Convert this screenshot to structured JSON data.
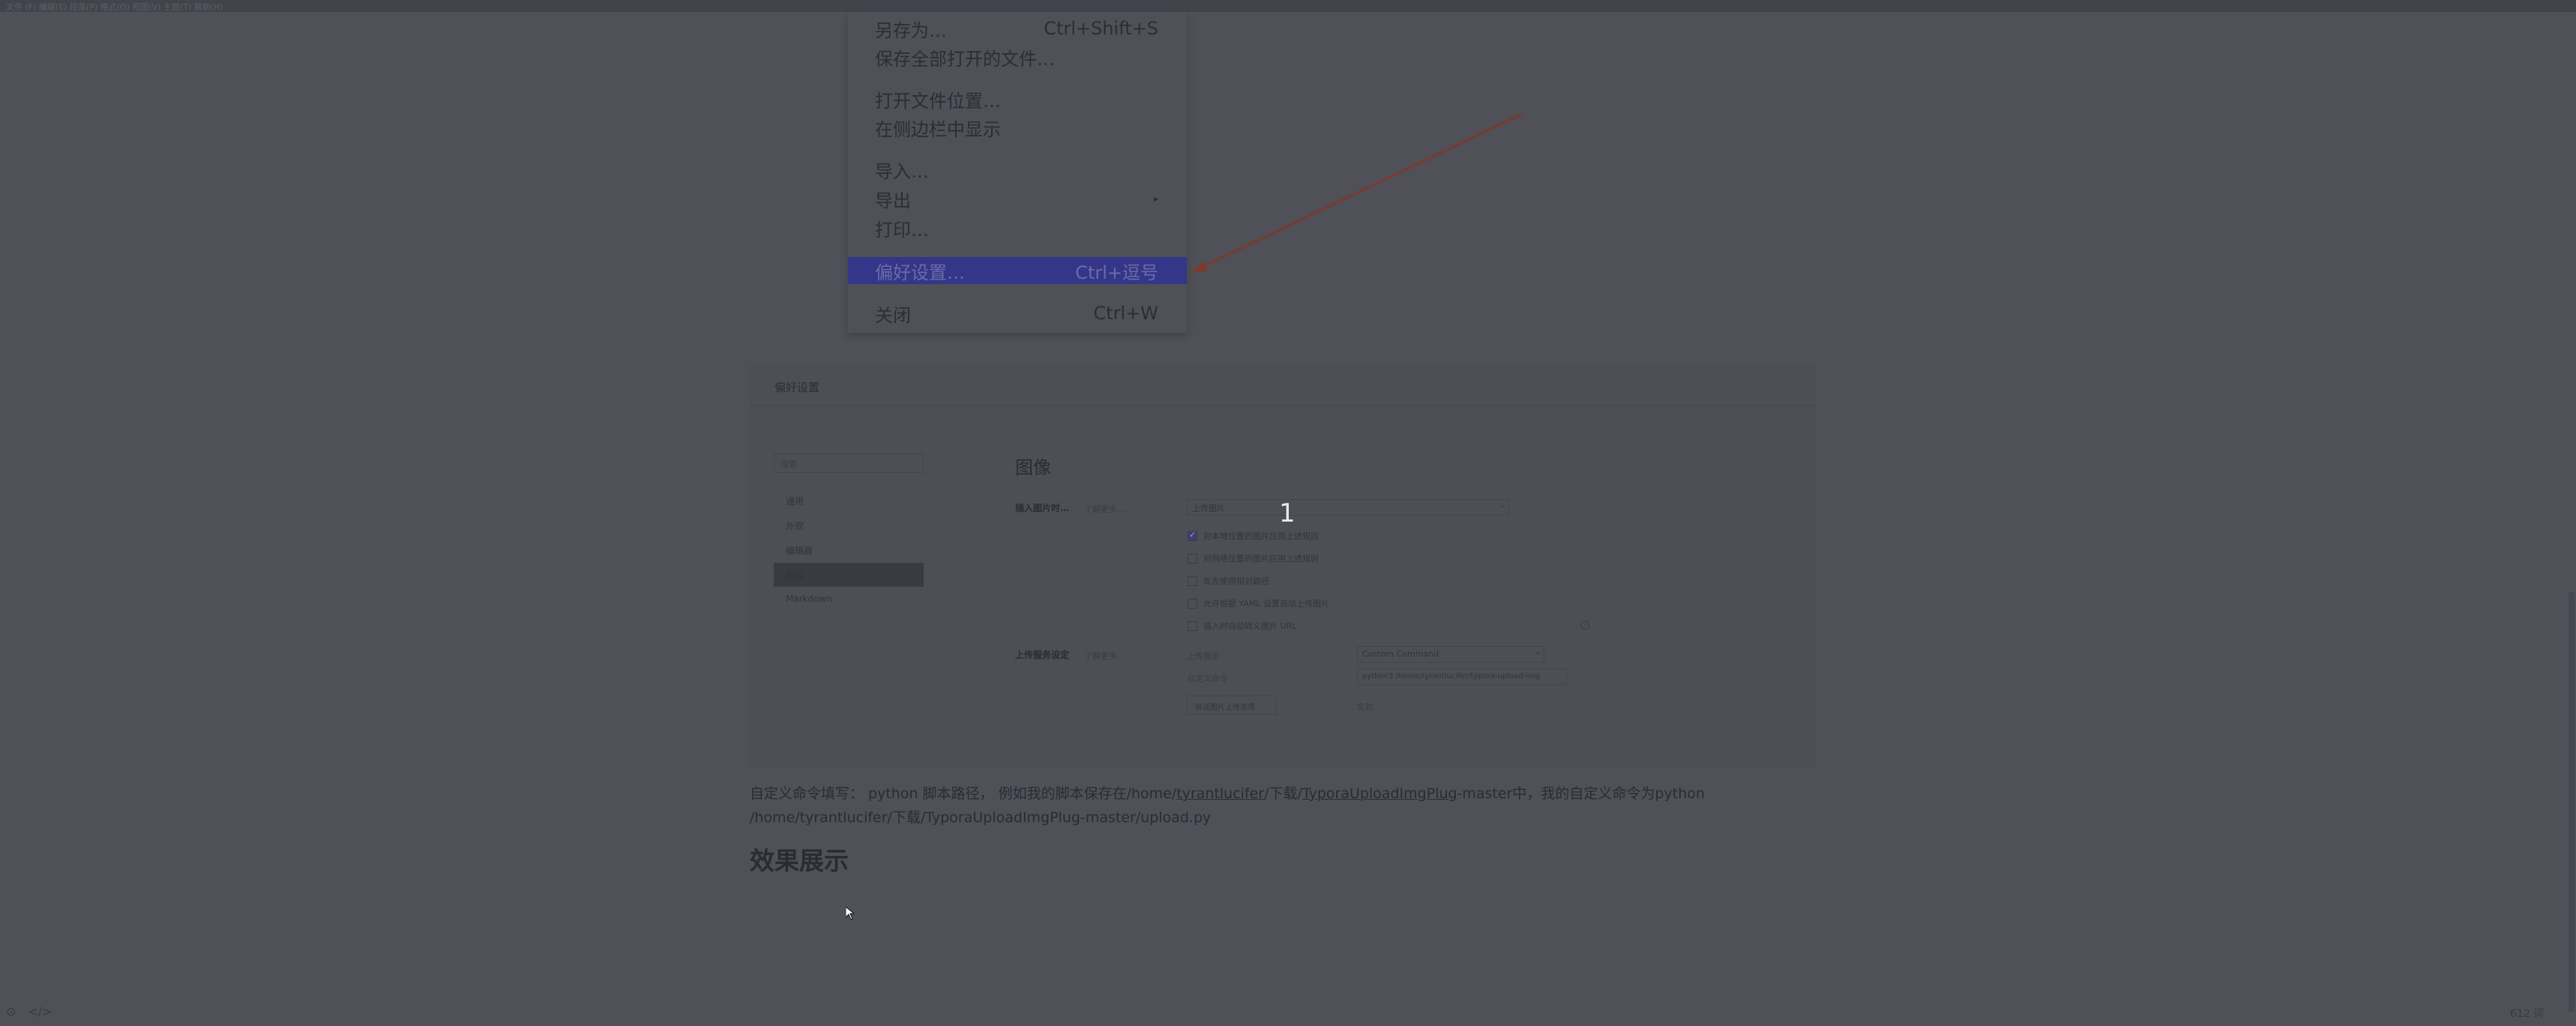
{
  "topbar": {
    "text": "文件 (F)  编辑(E)  段落(P)  格式(O)  视图(V)  主题(T)  帮助(H)"
  },
  "menu": {
    "items": [
      {
        "label": "另存为…",
        "shortcut": "Ctrl+Shift+S"
      },
      {
        "label": "保存全部打开的文件…",
        "shortcut": ""
      },
      {
        "label": "打开文件位置…",
        "shortcut": ""
      },
      {
        "label": "在侧边栏中显示",
        "shortcut": ""
      },
      {
        "label": "导入…",
        "shortcut": ""
      },
      {
        "label": "导出",
        "shortcut": ""
      },
      {
        "label": "打印…",
        "shortcut": ""
      },
      {
        "label": "偏好设置…",
        "shortcut": "Ctrl+逗号"
      },
      {
        "label": "关闭",
        "shortcut": "Ctrl+W"
      }
    ],
    "active_index": 7,
    "submenu_glyph": "▸"
  },
  "annotation": {
    "arrow_color": "#7a3a2e",
    "number": "1"
  },
  "prefs": {
    "title": "偏好设置",
    "search_placeholder": "搜索",
    "nav": [
      "通用",
      "外观",
      "编辑器",
      "图像",
      "Markdown"
    ],
    "selected_nav": 3,
    "heading": "图像",
    "insert_label": "插入图片时…",
    "insert_sublabel": "了解更多…",
    "insert_select": "上传图片",
    "checkboxes": [
      {
        "label": "对本地位置的图片应用上述规则",
        "checked": true
      },
      {
        "label": "对网络位置的图片应用上述规则",
        "checked": false
      },
      {
        "label": "优先使用相对路径",
        "checked": false
      },
      {
        "label": "允许根据 YAML 设置自动上传图片",
        "checked": false
      },
      {
        "label": "插入时自动转义图片 URL",
        "checked": false
      }
    ],
    "upload_label": "上传服务设定",
    "upload_sublabel": "了解更多…",
    "service_label": "上传服务",
    "service_value": "Custom Command",
    "command_label": "自定义命令",
    "command_value": "python3 /home/tyrantlucifer/typora-upload-img",
    "verify_button": "验证图片上传选项",
    "verify_hint": "实验"
  },
  "article": {
    "line1_parts": [
      "自定义命令填写： python 脚本路径， 例如我的脚本保存在/home/",
      "tyrantlucifer",
      "/下载/",
      "TyporaUploadImgPlug",
      "-master中，我的自定义命令为python"
    ],
    "line2": "/home/tyrantlucifer/下载/TyporaUploadImgPlug-master/upload.py",
    "section_title": "效果展示"
  },
  "status": {
    "left_icon1": "⊙",
    "left_icon2": "</>",
    "word_count": "612 词"
  }
}
